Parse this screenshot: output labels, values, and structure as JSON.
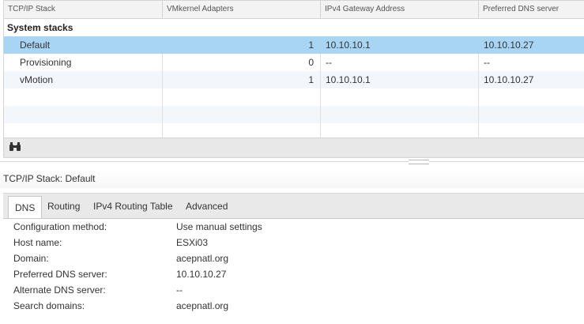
{
  "grid": {
    "columns": [
      "TCP/IP Stack",
      "VMkernel Adapters",
      "IPv4 Gateway Address",
      "Preferred DNS server"
    ],
    "group_label": "System stacks",
    "rows": [
      {
        "name": "Default",
        "adapters": "1",
        "gateway": "10.10.10.1",
        "dns": "10.10.10.27",
        "selected": true
      },
      {
        "name": "Provisioning",
        "adapters": "0",
        "gateway": "--",
        "dns": "--",
        "selected": false
      },
      {
        "name": "vMotion",
        "adapters": "1",
        "gateway": "10.10.10.1",
        "dns": "10.10.10.27",
        "selected": false
      }
    ],
    "footer_icon": "binoculars-icon"
  },
  "detail": {
    "title": "TCP/IP Stack: Default",
    "tabs": [
      "DNS",
      "Routing",
      "IPv4 Routing Table",
      "Advanced"
    ],
    "active_tab": "DNS",
    "properties": [
      {
        "label": "Configuration method:",
        "value": "Use manual settings"
      },
      {
        "label": "Host name:",
        "value": "ESXi03"
      },
      {
        "label": "Domain:",
        "value": "acepnatl.org"
      },
      {
        "label": "Preferred DNS server:",
        "value": "10.10.10.27"
      },
      {
        "label": "Alternate DNS server:",
        "value": "--"
      },
      {
        "label": "Search domains:",
        "value": "acepnatl.org"
      }
    ]
  },
  "colors": {
    "selected_row": "#a9d5f5",
    "alt_row": "#f3f6fa",
    "header_bg": "#f3f3f3"
  }
}
